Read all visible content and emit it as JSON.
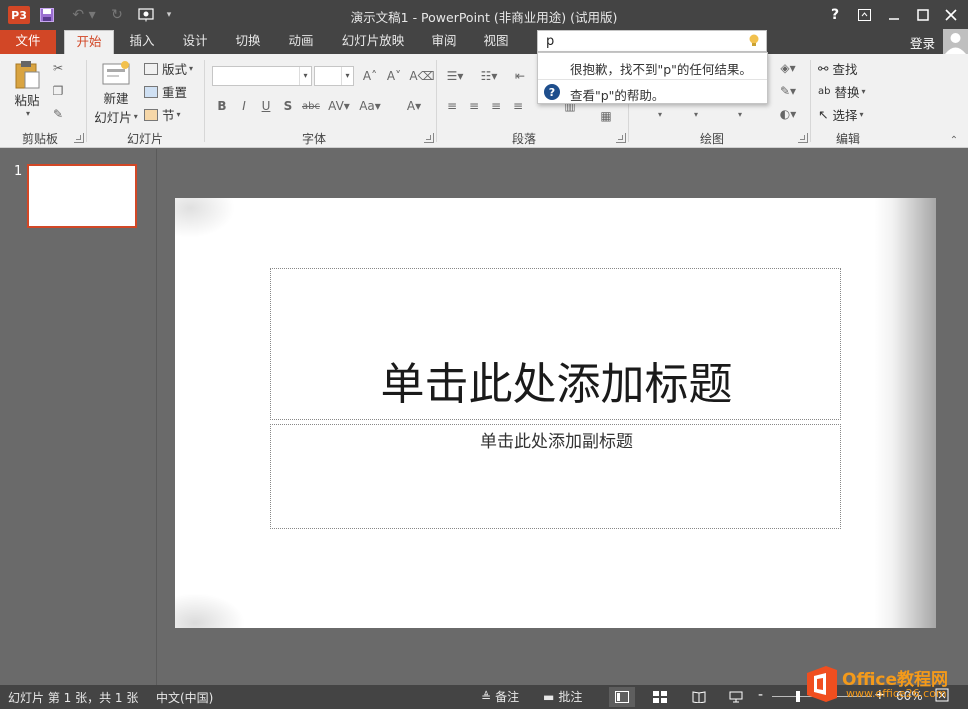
{
  "window": {
    "title": "演示文稿1 - PowerPoint (非商业用途) (试用版)",
    "app_badge": "P3"
  },
  "tabs": [
    {
      "label": "文件"
    },
    {
      "label": "开始"
    },
    {
      "label": "插入"
    },
    {
      "label": "设计"
    },
    {
      "label": "切换"
    },
    {
      "label": "动画"
    },
    {
      "label": "幻灯片放映"
    },
    {
      "label": "审阅"
    },
    {
      "label": "视图"
    }
  ],
  "tellme": {
    "value": "p",
    "no_results": "很抱歉，找不到\"p\"的任何结果。",
    "help_link": "查看\"p\"的帮助。"
  },
  "account": {
    "signin": "登录"
  },
  "ribbon": {
    "clipboard": {
      "label": "剪贴板",
      "paste": "粘贴"
    },
    "slides": {
      "label": "幻灯片",
      "new_slide_line1": "新建",
      "new_slide_line2": "幻灯片",
      "layout": "版式",
      "reset": "重置",
      "section": "节"
    },
    "font": {
      "label": "字体"
    },
    "paragraph": {
      "label": "段落"
    },
    "drawing": {
      "label": "绘图"
    },
    "editing": {
      "label": "编辑",
      "find": "查找",
      "replace": "替换",
      "select": "选择"
    }
  },
  "thumbnails": [
    {
      "number": "1"
    }
  ],
  "slide": {
    "title_placeholder": "单击此处添加标题",
    "subtitle_placeholder": "单击此处添加副标题"
  },
  "status": {
    "slide_counter": "幻灯片 第 1 张，共 1 张",
    "language": "中文(中国)",
    "notes": "备注",
    "comments": "批注",
    "zoom": "60%"
  },
  "watermark": {
    "brand": "Office教程网",
    "url": "www.office26.com"
  },
  "colors": {
    "accent": "#d24726",
    "chrome": "#444444",
    "ribbon": "#f1f1f1",
    "workspace": "#6a6a6a"
  }
}
